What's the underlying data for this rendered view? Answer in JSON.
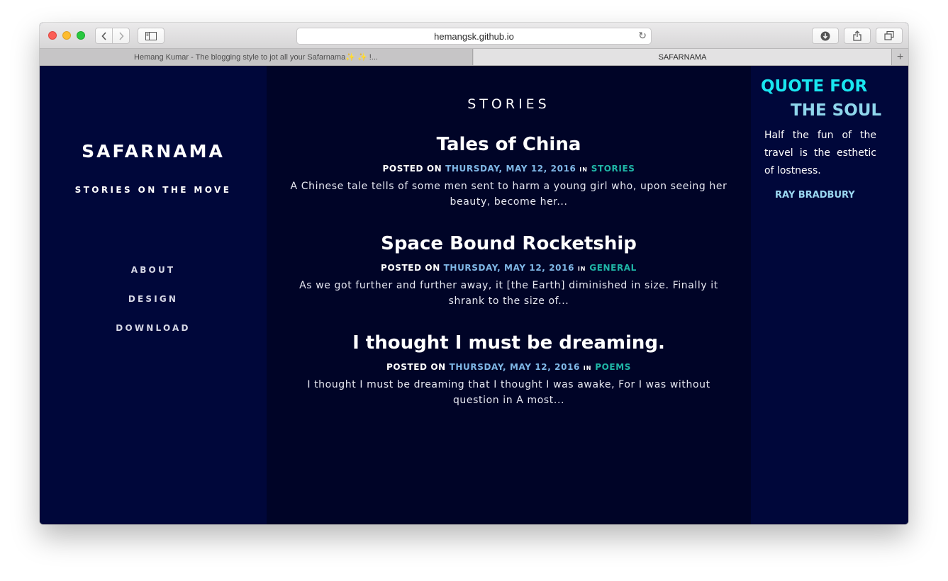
{
  "browser": {
    "url": "hemangsk.github.io",
    "tabs": [
      {
        "title": "Hemang Kumar - The blogging style to jot all your Safarnama✨ ✨ !...",
        "active": false
      },
      {
        "title": "SAFARNAMA",
        "active": true
      }
    ],
    "icons": {
      "back": "chevron-left-icon",
      "forward": "chevron-right-icon",
      "sidebar": "sidebar-icon",
      "reload": "reload-icon",
      "download": "download-icon",
      "share": "share-icon",
      "tabs": "tabs-overview-icon",
      "new_tab": "plus-icon"
    }
  },
  "site": {
    "title": "SAFARNAMA",
    "tagline": "STORIES ON THE MOVE",
    "nav": [
      {
        "label": "ABOUT"
      },
      {
        "label": "DESIGN"
      },
      {
        "label": "DOWNLOAD"
      }
    ]
  },
  "main": {
    "section_title": "STORIES",
    "posted_on_label": "POSTED ON",
    "in_label": "IN",
    "posts": [
      {
        "title": "Tales of China",
        "date": "THURSDAY, MAY 12, 2016",
        "category": "STORIES",
        "excerpt": "A Chinese tale tells of some men sent to harm a young girl who, upon seeing her beauty, become her..."
      },
      {
        "title": "Space Bound Rocketship",
        "date": "THURSDAY, MAY 12, 2016",
        "category": "GENERAL",
        "excerpt": "As we got further and further away, it [the Earth] diminished in size. Finally it shrank to the size of..."
      },
      {
        "title": "I thought I must be dreaming.",
        "date": "THURSDAY, MAY 12, 2016",
        "category": "POEMS",
        "excerpt": "I thought I must be dreaming that I thought I was awake, For I was without question in A most..."
      }
    ]
  },
  "sidebar_quote": {
    "heading_line1": "QUOTE FOR",
    "heading_line2": "THE SOUL",
    "text": "Half the fun of the travel is the esthetic of lostness.",
    "author": "RAY BRADBURY"
  },
  "colors": {
    "left_bg": "#00073a",
    "main_bg": "#000427",
    "date_link": "#7fb7e6",
    "category_link": "#1fb6a7",
    "quote_heading1": "#19e6f0",
    "quote_heading2": "#8fd6ec"
  }
}
